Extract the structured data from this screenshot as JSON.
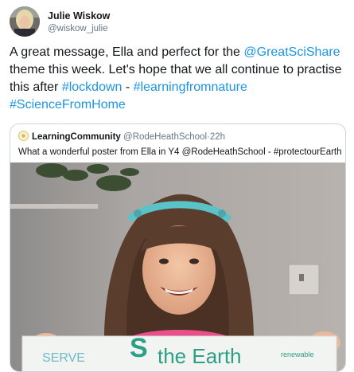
{
  "author": {
    "display_name": "Julie Wiskow",
    "handle": "@wiskow_julie",
    "avatar_icon": "profile-photo"
  },
  "tweet": {
    "seg1": "A great message, Ella and perfect for the ",
    "mention1": "@GreatSciShare",
    "seg2": " theme this week. Let's hope that we all continue to practise this after ",
    "hashtag1": "#lockdown",
    "seg3": " - ",
    "hashtag2": "#learningfromnature",
    "seg4": " ",
    "hashtag3": "#ScienceFromHome"
  },
  "quoted": {
    "name": "LearningCommunity",
    "handle": "@RodeHeathSchool",
    "separator": "·",
    "time": "22h",
    "text": "What a wonderful poster from Ella in Y4 @RodeHeathSchool - #protectourEarth",
    "photo": {
      "poster_text": "the Earth",
      "poster_text_left": "SERVE",
      "poster_text_right": "renewable"
    }
  },
  "colors": {
    "link": "#1b95e0",
    "secondary_text": "#657786",
    "border": "#ccd6dd",
    "poster_green": "#2f9e86"
  }
}
